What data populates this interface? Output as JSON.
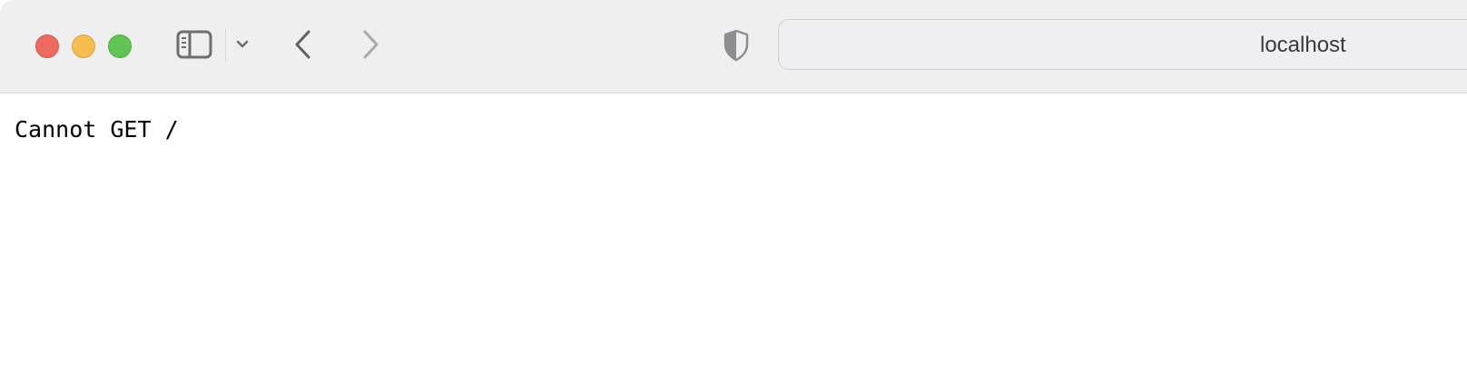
{
  "window": {
    "traffic_lights": {
      "close_color": "#ee6a5f",
      "minimize_color": "#f5bd4f",
      "zoom_color": "#61c454"
    }
  },
  "toolbar": {
    "icons": {
      "sidebar": "sidebar-icon",
      "sidebar_menu": "chevron-down-icon",
      "back": "chevron-left-icon",
      "forward": "chevron-right-icon",
      "privacy": "shield-icon"
    },
    "address": {
      "value": "localhost"
    }
  },
  "page": {
    "body_text": "Cannot GET /"
  }
}
